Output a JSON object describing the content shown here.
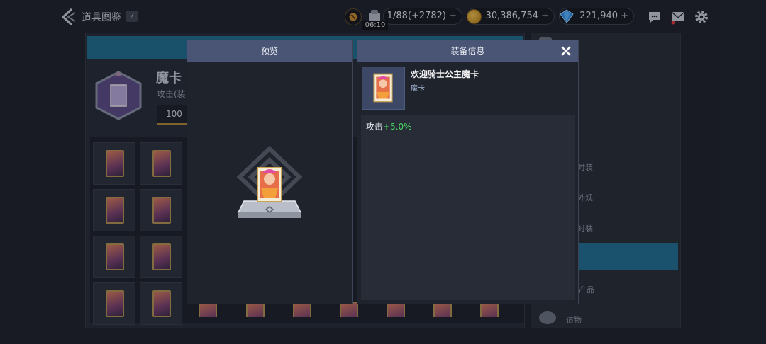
{
  "header": {
    "title": "道具图鉴",
    "help_label": "?",
    "resources": {
      "stamina": {
        "value": "1/88(+2782)",
        "timer": "06:10",
        "plus": "+"
      },
      "gold": {
        "value": "30,386,754",
        "plus": "+"
      },
      "gems": {
        "value": "221,940",
        "plus": "+"
      }
    },
    "icons": [
      "back-icon",
      "chat-icon",
      "mail-icon",
      "settings-icon"
    ]
  },
  "background_panel": {
    "title": "魔卡",
    "subtitle": "攻击(装",
    "count": "100"
  },
  "right_list": {
    "items": [
      {
        "label": "时装"
      },
      {
        "label": "外观"
      },
      {
        "label": "时装"
      },
      {
        "label": "产品"
      },
      {
        "label": "道物"
      }
    ]
  },
  "preview_dialog": {
    "title": "预览"
  },
  "info_dialog": {
    "title": "装备信息",
    "item_name": "欢迎骑士公主魔卡",
    "item_type": "魔卡",
    "stat_label": "攻击",
    "stat_value": "+5.0%"
  },
  "colors": {
    "accent_blue": "#1f6f93",
    "dialog_header": "#4a5474",
    "stat_green": "#4cd964",
    "card_border_gold": "#b39250"
  }
}
